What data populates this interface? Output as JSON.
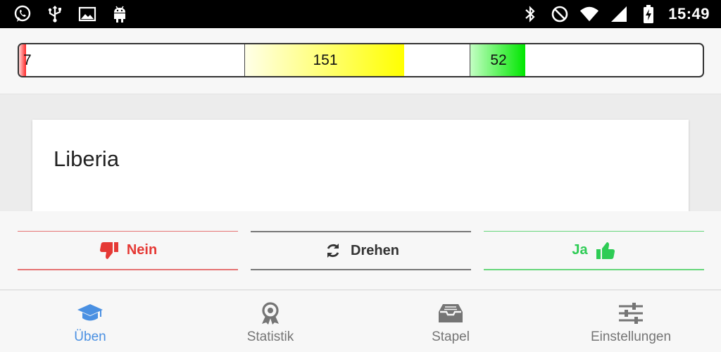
{
  "status_bar": {
    "left_icons": [
      "whatsapp-icon",
      "usb-icon",
      "image-icon",
      "android-icon"
    ],
    "right_icons": [
      "bluetooth-icon",
      "do-not-disturb-icon",
      "wifi-icon",
      "signal-icon",
      "battery-charging-icon"
    ],
    "time": "15:49"
  },
  "progress": {
    "segments": [
      {
        "name": "red",
        "count": "7",
        "fill_fraction": 0.03,
        "color": "#ff2626"
      },
      {
        "name": "yellow",
        "count": "151",
        "fill_fraction": 0.71,
        "color": "#ffff00"
      },
      {
        "name": "green",
        "count": "52",
        "fill_fraction": 0.245,
        "color": "#00e600"
      }
    ]
  },
  "card": {
    "text": "Liberia"
  },
  "actions": {
    "nein_label": "Nein",
    "drehen_label": "Drehen",
    "ja_label": "Ja",
    "colors": {
      "nein": "#e53935",
      "drehen": "#333333",
      "ja": "#2ecc55"
    }
  },
  "nav": {
    "items": [
      {
        "label": "Üben",
        "icon": "graduation-cap-icon",
        "active": true
      },
      {
        "label": "Statistik",
        "icon": "award-icon",
        "active": false
      },
      {
        "label": "Stapel",
        "icon": "inbox-tray-icon",
        "active": false
      },
      {
        "label": "Einstellungen",
        "icon": "sliders-icon",
        "active": false
      }
    ],
    "active_color": "#4a90e2",
    "inactive_color": "#757575"
  }
}
